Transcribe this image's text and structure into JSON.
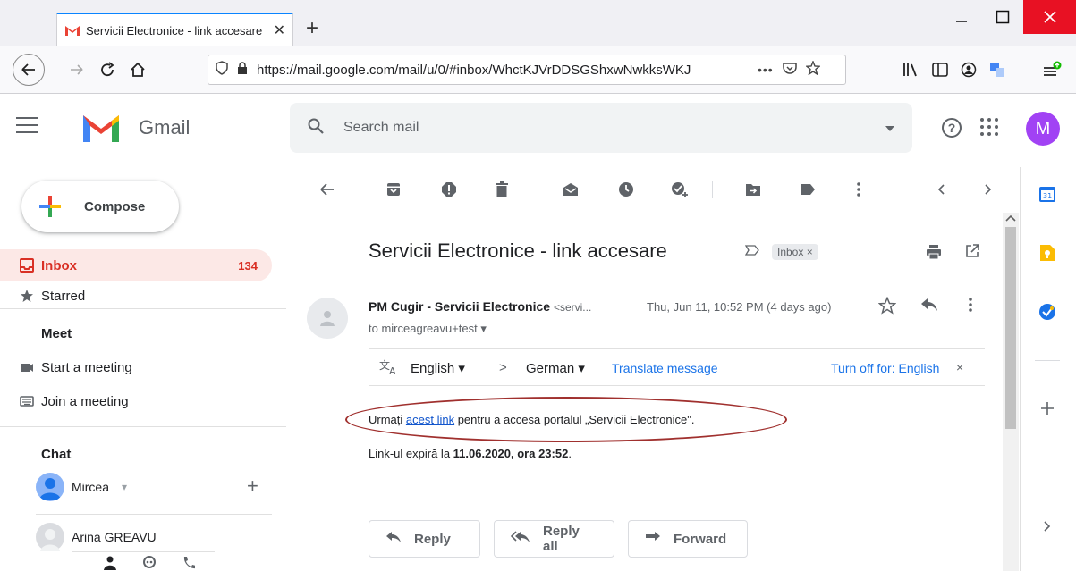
{
  "browser": {
    "tab_title": "Servicii Electronice - link accesare",
    "tab_close": "✕",
    "new_tab": "+",
    "url": "https://mail.google.com/mail/u/0/#inbox/WhctKJVrDDSGShxwNwkksWKJ",
    "url_more": "•••"
  },
  "gmail": {
    "brand": "Gmail",
    "search_placeholder": "Search mail",
    "avatar_letter": "M",
    "help_glyph": "?"
  },
  "sidebar": {
    "compose": "Compose",
    "inbox": "Inbox",
    "inbox_count": "134",
    "starred": "Starred",
    "meet_heading": "Meet",
    "start_meeting": "Start a meeting",
    "join_meeting": "Join a meeting",
    "chat_heading": "Chat",
    "chat_user1": "Mircea",
    "chat_user1_caret": "▾",
    "chat_add": "+",
    "chat_user2": "Arina GREAVU"
  },
  "message": {
    "subject": "Servicii Electronice - link accesare",
    "label": "Inbox ×",
    "sender_name": "PM Cugir - Servicii Electronice",
    "sender_email": "<servi...",
    "date": "Thu, Jun 11, 10:52 PM (4 days ago)",
    "to": "to mirceagreavu+test ▾",
    "translate": {
      "from": "English ▾",
      "arrow": ">",
      "to": "German ▾",
      "link": "Translate message",
      "off": "Turn off for: English",
      "close": "×"
    },
    "body_pre": "Urmați ",
    "body_link": "acest link",
    "body_post": " pentru a accesa portalul „Servicii Electronice\".",
    "body2_pre": "Link-ul expiră la ",
    "body2_bold": "11.06.2020, ora 23:52",
    "body2_post": "."
  },
  "actions": {
    "reply": "Reply",
    "reply_all": "Reply all",
    "forward": "Forward"
  },
  "colors": {
    "accent_red": "#d93025",
    "link_blue": "#1a73e8",
    "annotation_oval": "#a0302e"
  }
}
